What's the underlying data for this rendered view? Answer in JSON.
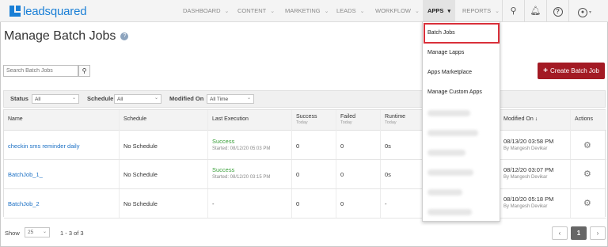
{
  "brand": {
    "name": "leadsquared"
  },
  "nav": {
    "items": [
      {
        "label": "DASHBOARD"
      },
      {
        "label": "CONTENT"
      },
      {
        "label": "MARKETING"
      },
      {
        "label": "LEADS"
      },
      {
        "label": "WORKFLOW"
      },
      {
        "label": "APPS"
      },
      {
        "label": "REPORTS"
      }
    ],
    "icons": [
      "search-icon",
      "bell-icon",
      "help-icon",
      "user-icon"
    ]
  },
  "page": {
    "title": "Manage Batch Jobs"
  },
  "search": {
    "placeholder": "Search Batch Jobs"
  },
  "create_button": {
    "label": "Create Batch Job"
  },
  "filters": {
    "status": {
      "label": "Status",
      "value": "All"
    },
    "schedule": {
      "label": "Schedule",
      "value": "All"
    },
    "modified": {
      "label": "Modified On",
      "value": "All Time"
    }
  },
  "table": {
    "headers": {
      "name": "Name",
      "schedule": "Schedule",
      "last_execution": "Last Execution",
      "success": "Success",
      "success_sub": "Today",
      "failed": "Failed",
      "failed_sub": "Today",
      "runtime": "Runtime",
      "runtime_sub": "Today",
      "modified": "Modified On",
      "actions": "Actions"
    },
    "rows": [
      {
        "name": "checkin sms reminder daily",
        "schedule": "No Schedule",
        "status": "Success",
        "started": "Started: 08/12/20 05:03 PM",
        "success": "0",
        "failed": "0",
        "runtime": "0s",
        "modified": "08/13/20 03:58 PM",
        "by": "By Mangesh Devikar"
      },
      {
        "name": "BatchJob_1_",
        "schedule": "No Schedule",
        "status": "Success",
        "started": "Started: 08/12/20 03:15 PM",
        "success": "0",
        "failed": "0",
        "runtime": "0s",
        "modified": "08/12/20 03:07 PM",
        "by": "By Mangesh Devikar"
      },
      {
        "name": "BatchJob_2",
        "schedule": "No Schedule",
        "status": "-",
        "started": "",
        "success": "0",
        "failed": "0",
        "runtime": "-",
        "modified": "08/10/20 05:18 PM",
        "by": "By Mangesh Devikar"
      }
    ]
  },
  "footer": {
    "show_label": "Show",
    "page_size": "25",
    "range": "1 - 3 of 3",
    "current_page": "1"
  },
  "apps_menu": {
    "items": [
      {
        "label": "Batch Jobs"
      },
      {
        "label": "Manage Lapps"
      },
      {
        "label": "Apps Marketplace"
      },
      {
        "label": "Manage Custom Apps"
      }
    ]
  },
  "colors": {
    "brand": "#1a7fd6",
    "create_button": "#a31a24",
    "highlight": "#d9303a",
    "success": "#3aa03a",
    "link": "#1a6fc4"
  }
}
